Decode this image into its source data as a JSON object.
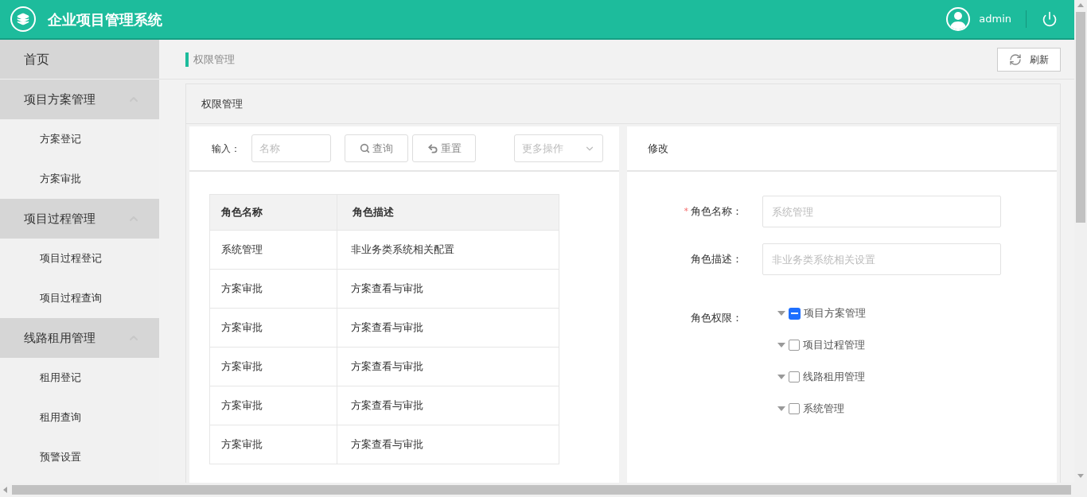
{
  "header": {
    "title": "企业项目管理系统",
    "user": "admin"
  },
  "sidebar": {
    "home": "首页",
    "groups": [
      {
        "label": "项目方案管理",
        "expanded": true,
        "items": [
          "方案登记",
          "方案审批"
        ]
      },
      {
        "label": "项目过程管理",
        "expanded": true,
        "items": [
          "项目过程登记",
          "项目过程查询"
        ]
      },
      {
        "label": "线路租用管理",
        "expanded": true,
        "items": [
          "租用登记",
          "租用查询",
          "预警设置"
        ]
      }
    ]
  },
  "breadcrumb": "权限管理",
  "refresh_button": "刷新",
  "panel_title": "权限管理",
  "toolbar": {
    "label": "输入：",
    "search_placeholder": "名称",
    "query_button": "查询",
    "reset_button": "重置",
    "more_select": "更多操作"
  },
  "table": {
    "columns": [
      "角色名称",
      "角色描述"
    ],
    "rows": [
      [
        "系统管理",
        "非业务类系统相关配置"
      ],
      [
        "方案审批",
        "方案查看与审批"
      ],
      [
        "方案审批",
        "方案查看与审批"
      ],
      [
        "方案审批",
        "方案查看与审批"
      ],
      [
        "方案审批",
        "方案查看与审批"
      ],
      [
        "方案审批",
        "方案查看与审批"
      ]
    ]
  },
  "edit": {
    "title": "修改",
    "fields": [
      {
        "label": "角色名称：",
        "required": true,
        "placeholder": "系统管理"
      },
      {
        "label": "角色描述：",
        "required": false,
        "placeholder": "非业务类系统相关设置"
      }
    ],
    "permissions_label": "角色权限：",
    "required_mark": "*",
    "tree": [
      {
        "label": "项目方案管理",
        "indeterminate": true,
        "expanded": false
      },
      {
        "label": "项目过程管理",
        "checked": false,
        "indeterminate": false,
        "expanded": false
      },
      {
        "label": "线路租用管理",
        "checked": false,
        "indeterminate": false,
        "expanded": false
      },
      {
        "label": "系统管理",
        "checked": false,
        "indeterminate": false,
        "expanded": false
      }
    ]
  }
}
